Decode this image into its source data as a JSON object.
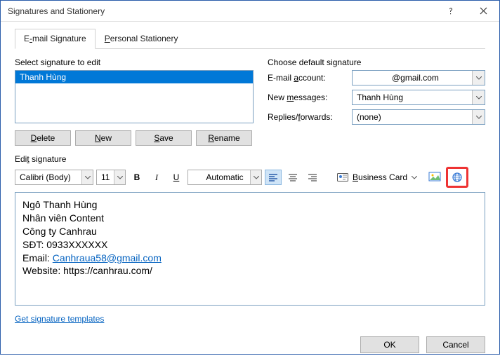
{
  "dialog": {
    "title": "Signatures and Stationery"
  },
  "tabs": {
    "email_html": "E<span class='uL'>-</span>mail Signature",
    "personal_html": "<span class='uL'>P</span>ersonal Stationery"
  },
  "left": {
    "select_label": "Select signature to edit",
    "items": [
      {
        "name": "Thanh Hùng"
      }
    ],
    "delete_html": "<span class='uL'>D</span>elete",
    "new_html": "<span class='uL'>N</span>ew",
    "save_html": "<span class='uL'>S</span>ave",
    "rename_html": "<span class='uL'>R</span>ename"
  },
  "right": {
    "choose_label": "Choose default signature",
    "account_label_html": "E-mail <span class='uL'>a</span>ccount:",
    "account_value": "@gmail.com",
    "newmsg_label_html": "New <span class='uL'>m</span>essages:",
    "newmsg_value": "Thanh Hùng",
    "replies_label_html": "Replies/<span class='uL'>f</span>orwards:",
    "replies_value": "(none)"
  },
  "edit": {
    "label_html": "Edi<span class='uL'>t</span> signature",
    "font": "Calibri (Body)",
    "size": "11",
    "color": "Automatic",
    "bizcard_html": "<span class='uL'>B</span>usiness Card"
  },
  "signature": {
    "line1": "Ngô Thanh Hùng",
    "line2": "Nhân viên Content",
    "line3": "Công ty Canhrau",
    "line4": "SĐT: 0933XXXXXX",
    "line5_prefix": "Email: ",
    "line5_link": "Canhraua58@gmail.com",
    "line6": "Website: https://canhrau.com/"
  },
  "templates_link": "Get signature templates",
  "footer": {
    "ok": "OK",
    "cancel": "Cancel"
  }
}
